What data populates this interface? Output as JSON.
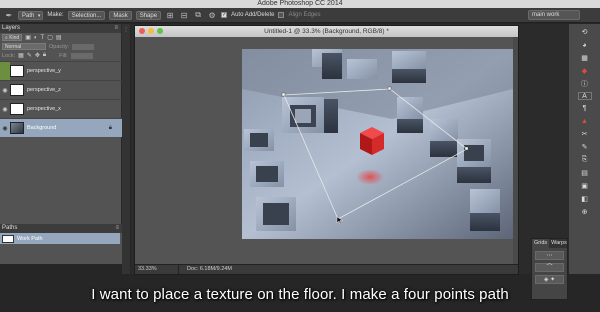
{
  "app": {
    "title": "Adobe Photoshop CC 2014"
  },
  "options_bar": {
    "tool_icon": "pen-tool-icon",
    "mode": "Path",
    "make_label": "Make:",
    "selection_button": "Selection...",
    "mask_button": "Mask",
    "shape_button": "Shape",
    "auto_add_delete": "Auto Add/Delete",
    "auto_add_delete_checked": true,
    "align_edges": "Align Edges",
    "workspace": "main work"
  },
  "layers_panel": {
    "title": "Layers",
    "filter_kind": "Kind",
    "blend_mode": "Normal",
    "opacity_label": "Opacity:",
    "lock_label": "Lock:",
    "fill_label": "Fill:",
    "layers": [
      {
        "name": "perspective_y",
        "visible": false,
        "thumbnail": "white",
        "active": false
      },
      {
        "name": "perspective_z",
        "visible": true,
        "thumbnail": "white",
        "active": false
      },
      {
        "name": "perspective_x",
        "visible": true,
        "thumbnail": "white",
        "active": false
      },
      {
        "name": "Background",
        "visible": true,
        "thumbnail": "image",
        "active": true,
        "locked": true
      }
    ]
  },
  "paths_panel": {
    "title": "Paths",
    "items": [
      {
        "name": "Work Path",
        "active": true
      }
    ]
  },
  "document": {
    "title": "Untitled-1 @ 33.3% (Background, RGB/8) *",
    "zoom": "33.33%",
    "doc_info": "Doc: 6.18M/9.24M"
  },
  "grid_panel": {
    "tabs": [
      "Grids",
      "Warps"
    ],
    "active_tab": "Grids"
  },
  "subtitle": "I want to place a texture on the floor. I make a four points path",
  "colors": {
    "accent_selection": "#94a7bd",
    "red_cube": "#d81e1e",
    "panel_bg": "#535353"
  }
}
